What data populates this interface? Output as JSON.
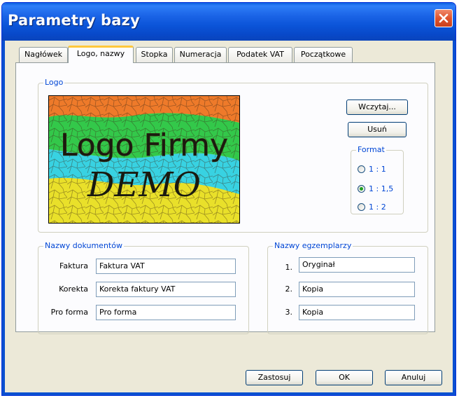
{
  "window": {
    "title": "Parametry bazy"
  },
  "tabs": [
    {
      "label": "Nagłówek",
      "active": false
    },
    {
      "label": "Logo, nazwy",
      "active": true
    },
    {
      "label": "Stopka",
      "active": false
    },
    {
      "label": "Numeracja",
      "active": false
    },
    {
      "label": "Podatek VAT",
      "active": false
    },
    {
      "label": "Początkowe",
      "active": false
    }
  ],
  "logo": {
    "group_label": "Logo",
    "image_text_line1": "Logo Firmy",
    "image_text_line2": "DEMO",
    "load_button": "Wczytaj...",
    "remove_button": "Usuń",
    "format": {
      "group_label": "Format",
      "options": [
        "1 : 1",
        "1 : 1,5",
        "1 : 2"
      ],
      "selected": "1 : 1,5"
    }
  },
  "document_names": {
    "group_label": "Nazwy dokumentów",
    "rows": [
      {
        "label": "Faktura",
        "value": "Faktura VAT"
      },
      {
        "label": "Korekta",
        "value": "Korekta faktury VAT"
      },
      {
        "label": "Pro forma",
        "value": "Pro forma"
      }
    ]
  },
  "copy_names": {
    "group_label": "Nazwy egzemplarzy",
    "rows": [
      {
        "label": "1.",
        "value": "Oryginał"
      },
      {
        "label": "2.",
        "value": "Kopia"
      },
      {
        "label": "3.",
        "value": "Kopia"
      }
    ]
  },
  "footer": {
    "apply_button": "Zastosuj",
    "ok_button": "OK",
    "cancel_button": "Anuluj"
  },
  "colors": {
    "title_bar": "#0b54d8",
    "group_label": "#0046d5",
    "close_button": "#e0542d",
    "active_tab_accent": "#ffc83c",
    "dialog_background": "#ece9d8"
  }
}
